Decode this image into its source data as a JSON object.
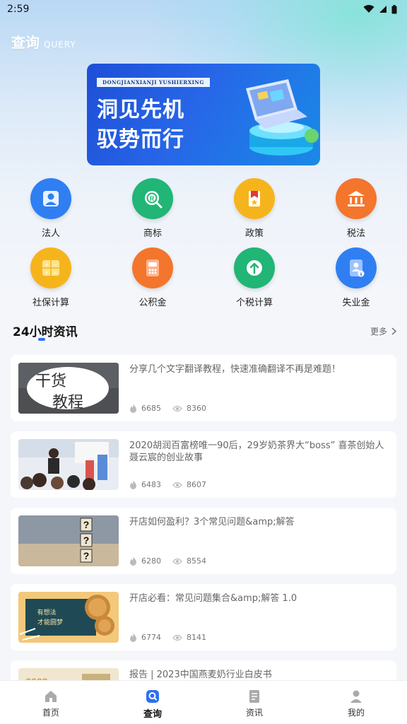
{
  "status_bar": {
    "time": "2:59"
  },
  "header": {
    "title_cn": "查询",
    "title_en": "QUERY"
  },
  "banner": {
    "subtitle": "DONGJIANXIANJI YUSHIERXING",
    "line1": "洞见先机",
    "line2": "驭势而行"
  },
  "grid": [
    {
      "label": "法人",
      "icon": "person-icon",
      "color": "#2f7ff3"
    },
    {
      "label": "商标",
      "icon": "trademark-icon",
      "color": "#21b576"
    },
    {
      "label": "政策",
      "icon": "policy-icon",
      "color": "#f6b41c"
    },
    {
      "label": "税法",
      "icon": "bank-icon",
      "color": "#f4752c"
    },
    {
      "label": "社保计算",
      "icon": "calculator-icon",
      "color": "#f6b41c"
    },
    {
      "label": "公积金",
      "icon": "fund-icon",
      "color": "#f4752c"
    },
    {
      "label": "个税计算",
      "icon": "tax-up-icon",
      "color": "#21b576"
    },
    {
      "label": "失业金",
      "icon": "badge-icon",
      "color": "#2f7ff3"
    }
  ],
  "section": {
    "title": "24小时资讯",
    "more": "更多"
  },
  "news": [
    {
      "title": "分享几个文字翻译教程，快速准确翻译不再是难题！",
      "likes": "6685",
      "views": "8360"
    },
    {
      "title": "2020胡润百富榜唯一90后，29岁奶茶界大“boss” 喜茶创始人聂云宸的创业故事",
      "likes": "6483",
      "views": "8607"
    },
    {
      "title": "开店如何盈利？3个常见问题&amp;解答",
      "likes": "6280",
      "views": "8554"
    },
    {
      "title": "开店必看：常见问题集合&amp;解答 1.0",
      "likes": "6774",
      "views": "8141"
    },
    {
      "title": "报告 | 2023中国燕麦奶行业白皮书",
      "likes": "",
      "views": ""
    }
  ],
  "thumbs": {
    "t1_top": "干货",
    "t1_bottom": "教程",
    "t4_text1": "有想法",
    "t4_text2": "才能圆梦",
    "t5_year": "2023"
  },
  "bottom_nav": [
    {
      "label": "首页",
      "icon": "home-icon"
    },
    {
      "label": "查询",
      "icon": "search-icon"
    },
    {
      "label": "资讯",
      "icon": "news-icon"
    },
    {
      "label": "我的",
      "icon": "profile-icon"
    }
  ],
  "colors": {
    "accent": "#2f6ff0",
    "nav_active": "#2f6ff0"
  }
}
